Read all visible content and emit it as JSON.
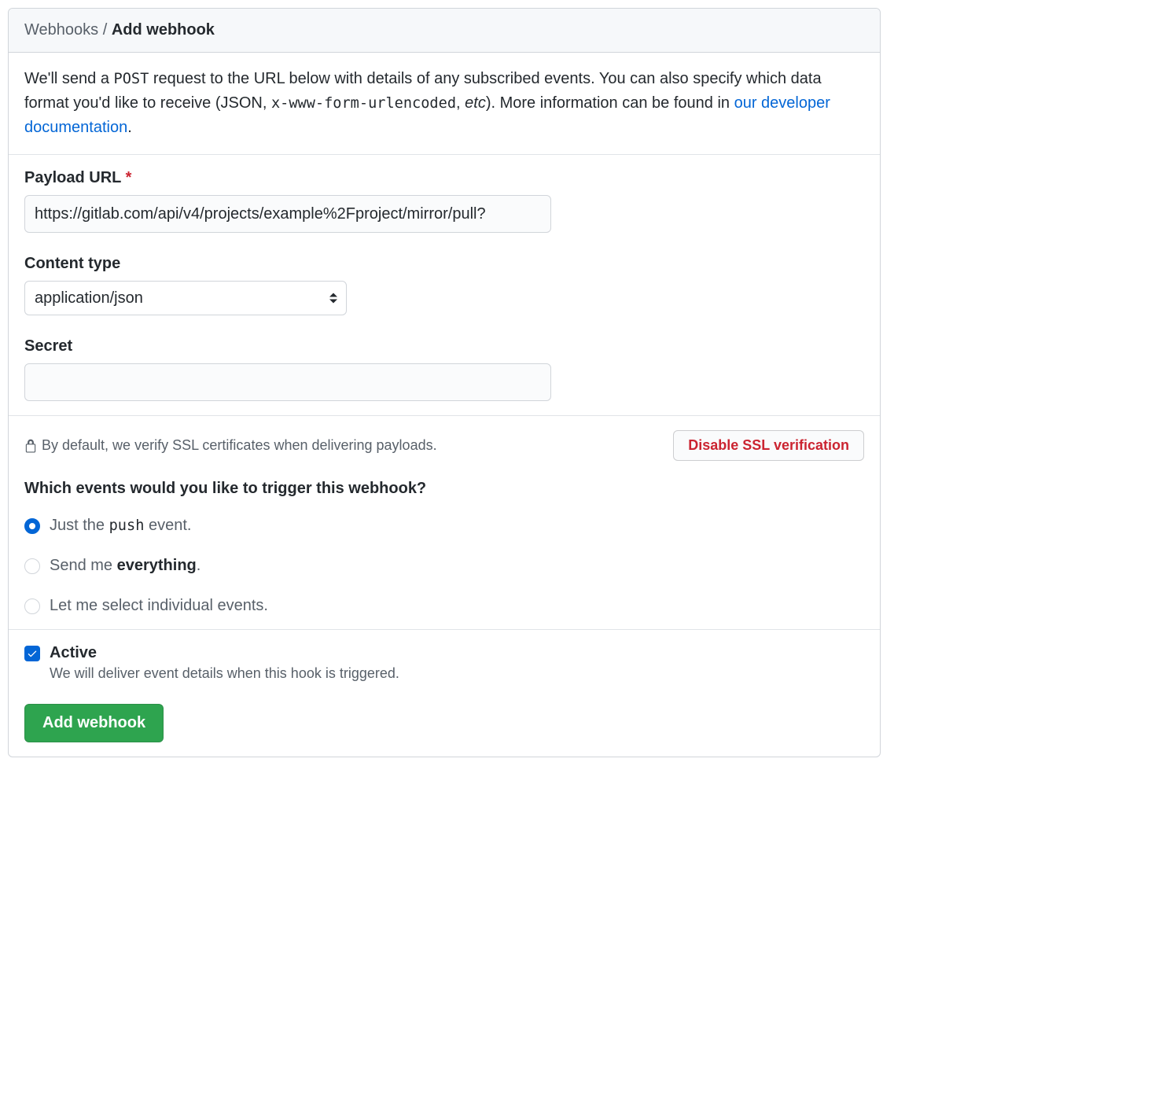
{
  "breadcrumb": {
    "root": "Webhooks",
    "sep": "/",
    "current": "Add webhook"
  },
  "intro": {
    "p1a": "We'll send a ",
    "p1_code": "POST",
    "p1b": " request to the URL below with details of any subscribed events. You can also specify which data format you'd like to receive (JSON, ",
    "p1_code2": "x-www-form-urlencoded",
    "p1c": ", ",
    "p1_em": "etc",
    "p1d": "). More information can be found in ",
    "link_text": "our developer documentation",
    "p1e": "."
  },
  "form": {
    "payload_url_label": "Payload URL",
    "required_mark": "*",
    "payload_url_value": "https://gitlab.com/api/v4/projects/example%2Fproject/mirror/pull?",
    "content_type_label": "Content type",
    "content_type_value": "application/json",
    "secret_label": "Secret",
    "secret_value": ""
  },
  "ssl": {
    "message": "By default, we verify SSL certificates when delivering payloads.",
    "disable_button": "Disable SSL verification"
  },
  "events": {
    "heading": "Which events would you like to trigger this webhook?",
    "options": [
      {
        "pre": "Just the ",
        "code": "push",
        "post": " event.",
        "checked": true
      },
      {
        "pre": "Send me ",
        "strong": "everything",
        "post": ".",
        "checked": false
      },
      {
        "pre": "Let me select individual events.",
        "checked": false
      }
    ]
  },
  "active": {
    "title": "Active",
    "desc": "We will deliver event details when this hook is triggered.",
    "checked": true
  },
  "submit": {
    "label": "Add webhook"
  }
}
